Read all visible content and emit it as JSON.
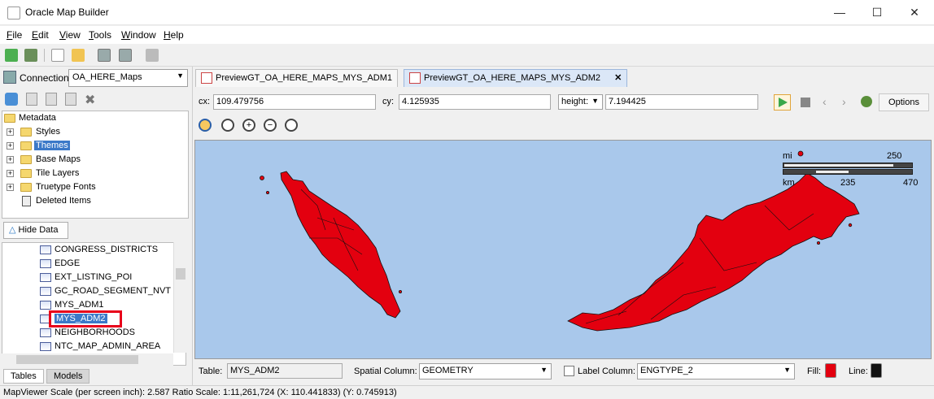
{
  "window": {
    "title": "Oracle Map Builder",
    "minimize": "—",
    "maximize": "☐",
    "close": "✕"
  },
  "menu": [
    {
      "label": "File",
      "mnemonic": "F",
      "rest": "ile"
    },
    {
      "label": "Edit",
      "mnemonic": "E",
      "rest": "dit"
    },
    {
      "label": "View",
      "mnemonic": "V",
      "rest": "iew"
    },
    {
      "label": "Tools",
      "mnemonic": "T",
      "rest": "ools"
    },
    {
      "label": "Window",
      "mnemonic": "W",
      "rest": "indow"
    },
    {
      "label": "Help",
      "mnemonic": "H",
      "rest": "elp"
    }
  ],
  "connection": {
    "label": "Connection:",
    "value": "OA_HERE_Maps"
  },
  "tree": {
    "root": "Metadata",
    "items": [
      "Styles",
      "Themes",
      "Base Maps",
      "Tile Layers",
      "Truetype Fonts",
      "Deleted Items"
    ],
    "selected": "Themes"
  },
  "hide_data_label": "Hide Data",
  "tables": [
    "CONGRESS_DISTRICTS",
    "EDGE",
    "EXT_LISTING_POI",
    "GC_ROAD_SEGMENT_NVT",
    "MYS_ADM1",
    "MYS_ADM2",
    "NEIGHBORHOODS",
    "NTC_MAP_ADMIN_AREA"
  ],
  "selected_table": "MYS_ADM2",
  "bottom_tabs": [
    "Tables",
    "Models"
  ],
  "doc_tabs": [
    {
      "label": "PreviewGT_OA_HERE_MAPS_MYS_ADM1",
      "active": false
    },
    {
      "label": "PreviewGT_OA_HERE_MAPS_MYS_ADM2",
      "active": true
    }
  ],
  "coords": {
    "cx_label": "cx:",
    "cx": "109.479756",
    "cy_label": "cy:",
    "cy": "4.125935",
    "mode": "height:",
    "height": "7.194425"
  },
  "options_label": "Options",
  "scalebar": {
    "mi_label": "mi",
    "mi_value": "250",
    "km_label": "km",
    "km_mid": "235",
    "km_max": "470"
  },
  "bottom": {
    "table_label": "Table:",
    "table_value": "MYS_ADM2",
    "spatial_label": "Spatial Column:",
    "spatial_value": "GEOMETRY",
    "label_col_label": "Label Column:",
    "label_col_value": "ENGTYPE_2",
    "fill_label": "Fill:",
    "line_label": "Line:"
  },
  "colors": {
    "fill": "#e3000f",
    "line": "#111111",
    "map_bg": "#a9c8eb",
    "selection": "#3b79c8"
  },
  "status": "MapViewer Scale (per screen inch): 2.587   Ratio Scale: 1:11,261,724      (X: 110.441833) (Y: 0.745913)"
}
